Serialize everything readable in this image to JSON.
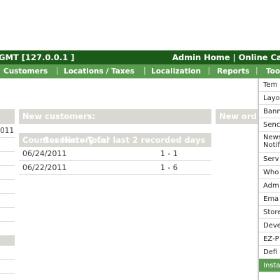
{
  "header": {
    "title": "GMT [127.0.0.1 ]",
    "links": "Admin Home | Online Ca"
  },
  "nav": {
    "items": [
      "Customers",
      "Locations / Taxes",
      "Localization",
      "Reports",
      "Too"
    ]
  },
  "tools_menu": {
    "items": [
      "Tem",
      "Layo",
      "Bann",
      "Senc",
      "News Notif",
      "Serv",
      "Who",
      "Adm",
      "Ema",
      "Store",
      "Deve",
      "EZ-P",
      "Defi",
      "Insta"
    ],
    "active_index": 13
  },
  "left_column": {
    "first_value": "011"
  },
  "panels": {
    "new_customers": "New customers:",
    "new_orders": "New ord"
  },
  "counter": {
    "title": "Counter History for last 2 recorded days",
    "columns": "Session - Total",
    "rows": [
      {
        "date": "06/24/2011",
        "value": "1 - 1"
      },
      {
        "date": "06/22/2011",
        "value": "1 - 6"
      }
    ]
  },
  "colors": {
    "header_bg": "#1c5a1a",
    "nav_bg": "#5a9c4f",
    "panel_head_bg": "#d9d8d2"
  }
}
